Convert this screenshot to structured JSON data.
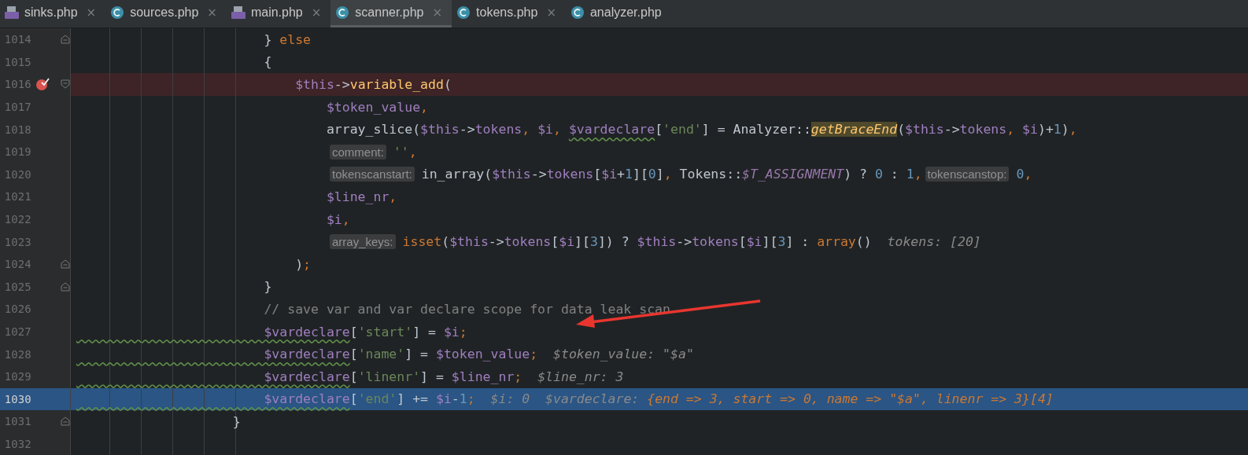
{
  "tabs": [
    {
      "label": "sinks.php",
      "kind": "php",
      "close": "×",
      "selected": false
    },
    {
      "label": "sources.php",
      "kind": "class",
      "close": "×",
      "selected": false
    },
    {
      "label": "main.php",
      "kind": "php",
      "close": "×",
      "selected": false
    },
    {
      "label": "scanner.php",
      "kind": "class",
      "close": "×",
      "selected": true
    },
    {
      "label": "tokens.php",
      "kind": "class",
      "close": "×",
      "selected": false
    },
    {
      "label": "analyzer.php",
      "kind": "class",
      "selected": false
    }
  ],
  "lines": [
    {
      "number": "1014",
      "breakpoint": false,
      "current": false,
      "fold_start": false,
      "fold_end": true,
      "tokens": [
        {
          "kind": "plain",
          "text": "                        } "
        },
        {
          "kind": "keyword",
          "text": "else"
        }
      ]
    },
    {
      "number": "1015",
      "breakpoint": false,
      "current": false,
      "fold_start": false,
      "fold_end": false,
      "tokens": [
        {
          "kind": "plain",
          "text": "                        {"
        }
      ]
    },
    {
      "number": "1016",
      "breakpoint": true,
      "current": false,
      "fold_start": true,
      "fold_end": false,
      "tokens": [
        {
          "kind": "variable",
          "text": "                            $this"
        },
        {
          "kind": "plain",
          "text": "->"
        },
        {
          "kind": "method",
          "text": "variable_add"
        },
        {
          "kind": "plain",
          "text": "("
        }
      ]
    },
    {
      "number": "1017",
      "breakpoint": false,
      "current": false,
      "fold_start": false,
      "fold_end": false,
      "tokens": [
        {
          "kind": "variable",
          "text": "                                $token_value"
        },
        {
          "kind": "keyword",
          "text": ","
        }
      ]
    },
    {
      "number": "1018",
      "breakpoint": false,
      "current": false,
      "fold_start": false,
      "fold_end": false,
      "tokens": [
        {
          "kind": "plain",
          "text": "                                array_slice("
        },
        {
          "kind": "variable",
          "text": "$this"
        },
        {
          "kind": "plain",
          "text": "->"
        },
        {
          "kind": "variable",
          "text": "tokens"
        },
        {
          "kind": "keyword",
          "text": ", "
        },
        {
          "kind": "variable",
          "text": "$i"
        },
        {
          "kind": "keyword",
          "text": ", "
        },
        {
          "kind": "warned",
          "text": "$vardeclare"
        },
        {
          "kind": "plain",
          "text": "["
        },
        {
          "kind": "string",
          "text": "'end'"
        },
        {
          "kind": "plain",
          "text": "] = Analyzer::"
        },
        {
          "kind": "highlight",
          "text": "getBraceEnd"
        },
        {
          "kind": "plain",
          "text": "("
        },
        {
          "kind": "variable",
          "text": "$this"
        },
        {
          "kind": "plain",
          "text": "->"
        },
        {
          "kind": "variable",
          "text": "tokens"
        },
        {
          "kind": "keyword",
          "text": ", "
        },
        {
          "kind": "variable",
          "text": "$i"
        },
        {
          "kind": "plain",
          "text": ")+"
        },
        {
          "kind": "number",
          "text": "1"
        },
        {
          "kind": "plain",
          "text": ")"
        },
        {
          "kind": "keyword",
          "text": ","
        }
      ]
    },
    {
      "number": "1019",
      "breakpoint": false,
      "current": false,
      "fold_start": false,
      "fold_end": false,
      "tokens": [
        {
          "kind": "hint",
          "text": "comment:"
        },
        {
          "kind": "string",
          "text": "''"
        },
        {
          "kind": "keyword",
          "text": ","
        }
      ]
    },
    {
      "number": "1020",
      "breakpoint": false,
      "current": false,
      "fold_start": false,
      "fold_end": false,
      "tokens": [
        {
          "kind": "hint",
          "text": "tokenscanstart:"
        },
        {
          "kind": "plain",
          "text": "in_array("
        },
        {
          "kind": "variable",
          "text": "$this"
        },
        {
          "kind": "plain",
          "text": "->"
        },
        {
          "kind": "variable",
          "text": "tokens"
        },
        {
          "kind": "plain",
          "text": "["
        },
        {
          "kind": "variable",
          "text": "$i"
        },
        {
          "kind": "plain",
          "text": "+"
        },
        {
          "kind": "number",
          "text": "1"
        },
        {
          "kind": "plain",
          "text": "]["
        },
        {
          "kind": "number",
          "text": "0"
        },
        {
          "kind": "plain",
          "text": "]"
        },
        {
          "kind": "keyword",
          "text": ","
        },
        {
          "kind": "plain",
          "text": " Tokens::"
        },
        {
          "kind": "constant",
          "text": "$T_ASSIGNMENT"
        },
        {
          "kind": "plain",
          "text": ") ? "
        },
        {
          "kind": "number",
          "text": "0"
        },
        {
          "kind": "plain",
          "text": " : "
        },
        {
          "kind": "number",
          "text": "1"
        },
        {
          "kind": "keyword",
          "text": ","
        },
        {
          "kind": "hint",
          "text": "tokenscanstop:"
        },
        {
          "kind": "number",
          "text": "0"
        },
        {
          "kind": "keyword",
          "text": ","
        }
      ]
    },
    {
      "number": "1021",
      "breakpoint": false,
      "current": false,
      "fold_start": false,
      "fold_end": false,
      "tokens": [
        {
          "kind": "variable",
          "text": "                                $line_nr"
        },
        {
          "kind": "keyword",
          "text": ","
        }
      ]
    },
    {
      "number": "1022",
      "breakpoint": false,
      "current": false,
      "fold_start": false,
      "fold_end": false,
      "tokens": [
        {
          "kind": "variable",
          "text": "                                $i"
        },
        {
          "kind": "keyword",
          "text": ","
        }
      ]
    },
    {
      "number": "1023",
      "breakpoint": false,
      "current": false,
      "fold_start": false,
      "fold_end": false,
      "tokens": [
        {
          "kind": "hint",
          "text": "array_keys:"
        },
        {
          "kind": "keyword",
          "text": "isset"
        },
        {
          "kind": "plain",
          "text": "("
        },
        {
          "kind": "variable",
          "text": "$this"
        },
        {
          "kind": "plain",
          "text": "->"
        },
        {
          "kind": "variable",
          "text": "tokens"
        },
        {
          "kind": "plain",
          "text": "["
        },
        {
          "kind": "variable",
          "text": "$i"
        },
        {
          "kind": "plain",
          "text": "]["
        },
        {
          "kind": "number",
          "text": "3"
        },
        {
          "kind": "plain",
          "text": "]) ? "
        },
        {
          "kind": "variable",
          "text": "$this"
        },
        {
          "kind": "plain",
          "text": "->"
        },
        {
          "kind": "variable",
          "text": "tokens"
        },
        {
          "kind": "plain",
          "text": "["
        },
        {
          "kind": "variable",
          "text": "$i"
        },
        {
          "kind": "plain",
          "text": "]["
        },
        {
          "kind": "number",
          "text": "3"
        },
        {
          "kind": "plain",
          "text": "] : "
        },
        {
          "kind": "keyword",
          "text": "array"
        },
        {
          "kind": "plain",
          "text": "()"
        },
        {
          "kind": "value",
          "text": "  tokens: [20]"
        }
      ]
    },
    {
      "number": "1024",
      "breakpoint": false,
      "current": false,
      "fold_start": false,
      "fold_end": true,
      "tokens": [
        {
          "kind": "plain",
          "text": "                            )"
        },
        {
          "kind": "keyword",
          "text": ";"
        }
      ]
    },
    {
      "number": "1025",
      "breakpoint": false,
      "current": false,
      "fold_start": false,
      "fold_end": true,
      "tokens": [
        {
          "kind": "plain",
          "text": "                        }"
        }
      ]
    },
    {
      "number": "1026",
      "breakpoint": false,
      "current": false,
      "fold_start": false,
      "fold_end": false,
      "tokens": [
        {
          "kind": "comment",
          "text": "                        // save var and var declare scope for data leak scan"
        }
      ]
    },
    {
      "number": "1027",
      "breakpoint": false,
      "current": false,
      "fold_start": false,
      "fold_end": false,
      "tokens": [
        {
          "kind": "warned",
          "text": "                        $vardeclare"
        },
        {
          "kind": "plain",
          "text": "["
        },
        {
          "kind": "string",
          "text": "'start'"
        },
        {
          "kind": "plain",
          "text": "] = "
        },
        {
          "kind": "variable",
          "text": "$i"
        },
        {
          "kind": "keyword",
          "text": ";"
        }
      ]
    },
    {
      "number": "1028",
      "breakpoint": false,
      "current": false,
      "fold_start": false,
      "fold_end": false,
      "tokens": [
        {
          "kind": "warned",
          "text": "                        $vardeclare"
        },
        {
          "kind": "plain",
          "text": "["
        },
        {
          "kind": "string",
          "text": "'name'"
        },
        {
          "kind": "plain",
          "text": "] = "
        },
        {
          "kind": "variable",
          "text": "$token_value"
        },
        {
          "kind": "keyword",
          "text": ";"
        },
        {
          "kind": "value",
          "text": "  $token_value: \"$a\""
        }
      ]
    },
    {
      "number": "1029",
      "breakpoint": false,
      "current": false,
      "fold_start": false,
      "fold_end": false,
      "tokens": [
        {
          "kind": "warned",
          "text": "                        $vardeclare"
        },
        {
          "kind": "plain",
          "text": "["
        },
        {
          "kind": "string",
          "text": "'linenr'"
        },
        {
          "kind": "plain",
          "text": "] = "
        },
        {
          "kind": "variable",
          "text": "$line_nr"
        },
        {
          "kind": "keyword",
          "text": ";"
        },
        {
          "kind": "value",
          "text": "  $line_nr: 3"
        }
      ]
    },
    {
      "number": "1030",
      "breakpoint": false,
      "current": true,
      "fold_start": false,
      "fold_end": false,
      "tokens": [
        {
          "kind": "warned",
          "text": "                        $vardeclare"
        },
        {
          "kind": "plain",
          "text": "["
        },
        {
          "kind": "string",
          "text": "'end'"
        },
        {
          "kind": "plain",
          "text": "] += "
        },
        {
          "kind": "variable",
          "text": "$i"
        },
        {
          "kind": "plain",
          "text": "-"
        },
        {
          "kind": "number",
          "text": "1"
        },
        {
          "kind": "keyword",
          "text": ";"
        },
        {
          "kind": "value",
          "text": "  $i: 0  $vardeclare: "
        },
        {
          "kind": "changed",
          "text": "{end => 3, start => 0, name => \"$a\", linenr => 3}[4]"
        }
      ]
    },
    {
      "number": "1031",
      "breakpoint": false,
      "current": false,
      "fold_start": false,
      "fold_end": true,
      "tokens": [
        {
          "kind": "plain",
          "text": "                    }"
        }
      ]
    },
    {
      "number": "1032",
      "breakpoint": false,
      "current": false,
      "fold_start": false,
      "fold_end": false
    }
  ]
}
